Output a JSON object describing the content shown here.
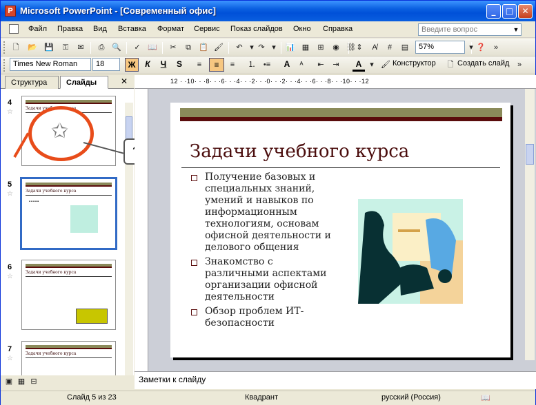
{
  "window": {
    "title": "Microsoft PowerPoint - [Современный офис]",
    "app_icon_letter": "P"
  },
  "menu": [
    "Файл",
    "Правка",
    "Вид",
    "Вставка",
    "Формат",
    "Сервис",
    "Показ слайдов",
    "Окно",
    "Справка"
  ],
  "help_placeholder": "Введите вопрос",
  "zoom": "57%",
  "font": {
    "name": "Times New Roman",
    "size": "18"
  },
  "format_buttons": {
    "bold": "Ж",
    "italic": "К",
    "underline": "Ч",
    "shadow": "S",
    "font_grow": "A",
    "font_color": "A"
  },
  "toolbar_text": {
    "designer": "Конструктор",
    "new_slide": "Создать слайд"
  },
  "tabs": {
    "outline": "Структура",
    "slides": "Слайды"
  },
  "slides": [
    {
      "number": "4",
      "title": "Задачи учебного курса",
      "selected": false
    },
    {
      "number": "5",
      "title": "Задачи учебного курса",
      "selected": true
    },
    {
      "number": "6",
      "title": "Задачи учебного курса",
      "selected": false
    },
    {
      "number": "7",
      "title": "Задачи учебного курса",
      "selected": false
    }
  ],
  "callout": {
    "question": "?"
  },
  "ruler": {
    "h_ticks": "12 · ·10· · ·8· · ·6· · ·4· · ·2· · ·0· · ·2· · ·4· · ·6· · ·8· · ·10· · ·12"
  },
  "slide": {
    "title": "Задачи учебного курса",
    "bullets": [
      "Получение базовых и специальных знаний, умений и навыков по информационным технологиям, основам офисной деятельности и делового общения",
      "Знакомство с различными аспектами организации офисной деятельности",
      "Обзор проблем ИТ-безопасности"
    ]
  },
  "notes_placeholder": "Заметки к слайду",
  "status": {
    "slide_pos": "Слайд 5 из 23",
    "design": "Квадрант",
    "language": "русский (Россия)"
  },
  "colors": {
    "title_bar": "#0a5fe0",
    "accent_red": "#e84c1a",
    "slide_title": "#4a0c0c"
  }
}
